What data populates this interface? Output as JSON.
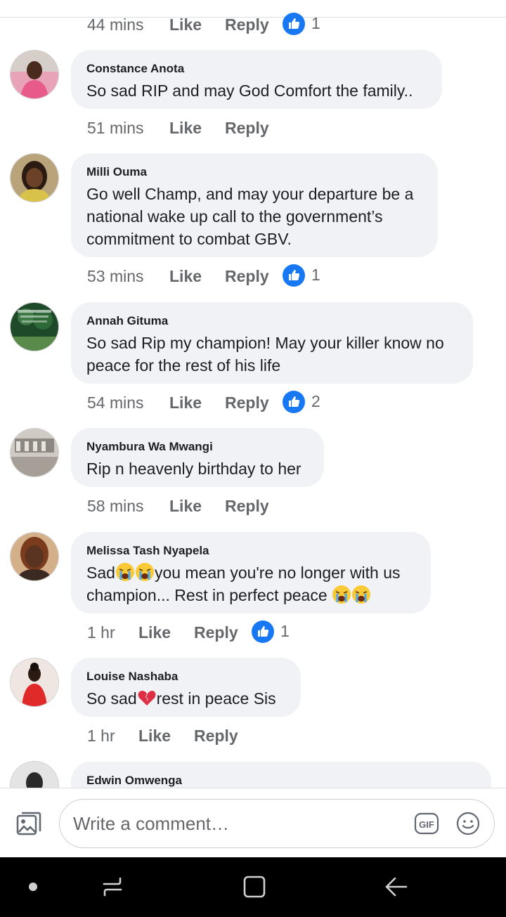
{
  "actions": {
    "like": "Like",
    "reply": "Reply"
  },
  "top_meta": {
    "time": "44 mins",
    "reactions": "1"
  },
  "comments": [
    {
      "author": "Constance Anota",
      "text": "So sad RIP and may God Comfort the family..",
      "time": "51 mins",
      "reactions": ""
    },
    {
      "author": "Milli Ouma",
      "text": "Go well Champ, and may your departure be a national wake up call to the government’s commitment to combat GBV.",
      "time": "53 mins",
      "reactions": "1"
    },
    {
      "author": "Annah Gituma",
      "text": "So sad Rip my champion! May your killer know no peace for the rest of his life",
      "time": "54 mins",
      "reactions": "2"
    },
    {
      "author": "Nyambura Wa Mwangi",
      "text": "Rip n heavenly birthday to her",
      "time": "58 mins",
      "reactions": ""
    },
    {
      "author": "Melissa Tash Nyapela",
      "text_parts": [
        "Sad",
        "you mean you're no longer with us champion... Rest in perfect peace"
      ],
      "emoji": "loudly-crying-face",
      "time": "1 hr",
      "reactions": "1"
    },
    {
      "author": "Louise Nashaba",
      "text_parts": [
        "So sad",
        "rest in peace Sis"
      ],
      "emoji": "broken-heart",
      "time": "1 hr",
      "reactions": ""
    },
    {
      "author": "Edwin Omwenga"
    }
  ],
  "composer": {
    "placeholder": "Write a comment…",
    "gif_label": "GIF"
  },
  "icons": {
    "like_reaction": "thumbs-up-icon",
    "gallery": "photo-gallery-icon",
    "emoji": "smiley-icon",
    "nav": [
      "dot-icon",
      "recent-apps-icon",
      "home-icon",
      "back-icon"
    ]
  },
  "colors": {
    "facebook_blue": "#1877f2",
    "bubble_bg": "#f0f2f5",
    "meta_text": "#65676b",
    "nav_bg": "#000000"
  }
}
